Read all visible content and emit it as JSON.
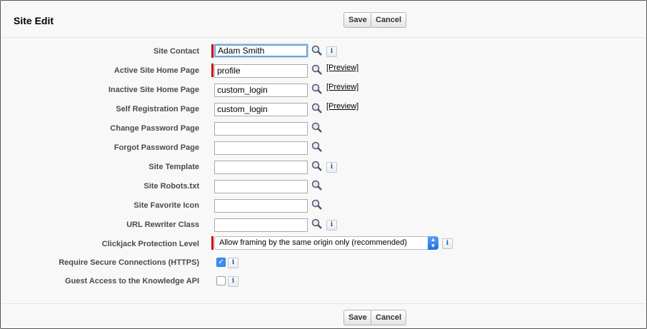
{
  "header": {
    "title": "Site Edit",
    "save_label": "Save",
    "cancel_label": "Cancel"
  },
  "fields": {
    "site_contact": {
      "label": "Site Contact",
      "value": "Adam Smith"
    },
    "active_home": {
      "label": "Active Site Home Page",
      "value": "profile",
      "preview": "[Preview]"
    },
    "inactive_home": {
      "label": "Inactive Site Home Page",
      "value": "custom_login",
      "preview": "[Preview]"
    },
    "self_reg": {
      "label": "Self Registration Page",
      "value": "custom_login",
      "preview": "[Preview]"
    },
    "change_pw": {
      "label": "Change Password Page",
      "value": ""
    },
    "forgot_pw": {
      "label": "Forgot Password Page",
      "value": ""
    },
    "site_template": {
      "label": "Site Template",
      "value": ""
    },
    "robots": {
      "label": "Site Robots.txt",
      "value": ""
    },
    "favicon": {
      "label": "Site Favorite Icon",
      "value": ""
    },
    "url_rewriter": {
      "label": "URL Rewriter Class",
      "value": ""
    },
    "clickjack": {
      "label": "Clickjack Protection Level",
      "value": "Allow framing by the same origin only (recommended)"
    },
    "https": {
      "label": "Require Secure Connections (HTTPS)",
      "checked": true
    },
    "guest_api": {
      "label": "Guest Access to the Knowledge API",
      "checked": false
    }
  },
  "footer": {
    "save_label": "Save",
    "cancel_label": "Cancel"
  },
  "icons": {
    "lookup": "magnifier-lookup-icon",
    "info": "info-icon"
  },
  "colors": {
    "required": "#cc0000",
    "accent": "#3f8ef4"
  }
}
